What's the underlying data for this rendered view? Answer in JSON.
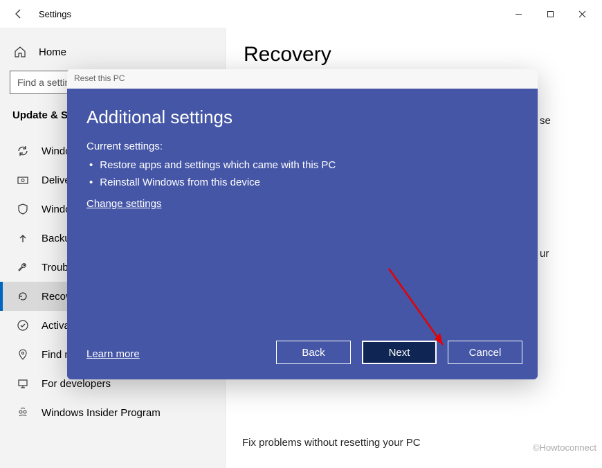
{
  "window": {
    "title": "Settings"
  },
  "sidebar": {
    "home": "Home",
    "search_placeholder": "Find a setting",
    "section": "Update & Security",
    "items": [
      {
        "label": "Windows Update"
      },
      {
        "label": "Delivery Optimization"
      },
      {
        "label": "Windows Security"
      },
      {
        "label": "Backup"
      },
      {
        "label": "Troubleshoot"
      },
      {
        "label": "Recovery"
      },
      {
        "label": "Activation"
      },
      {
        "label": "Find my device"
      },
      {
        "label": "For developers"
      },
      {
        "label": "Windows Insider Program"
      }
    ]
  },
  "page": {
    "title": "Recovery",
    "peek1": "se",
    "peek2": "ur",
    "subtext": "Fix problems without resetting your PC"
  },
  "dialog": {
    "title": "Reset this PC",
    "heading": "Additional settings",
    "current_label": "Current settings:",
    "bullets": [
      "Restore apps and settings which came with this PC",
      "Reinstall Windows from this device"
    ],
    "change": "Change settings",
    "learn": "Learn more",
    "back": "Back",
    "next": "Next",
    "cancel": "Cancel"
  },
  "watermark": "©Howtoconnect"
}
